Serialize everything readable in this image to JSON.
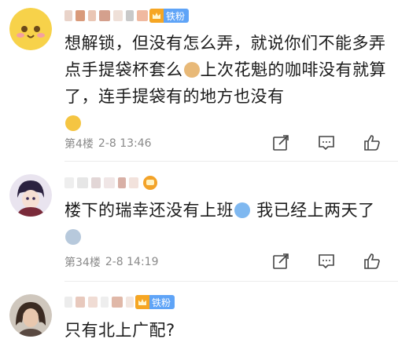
{
  "comments": [
    {
      "badge_label": "铁粉",
      "text_parts": [
        "想解锁，但没有怎么弄，就说你们不能多弄点手提袋杯套么",
        "上次花魁的咖啡没有就算了，连手提袋有的地方也没有"
      ],
      "floor": "第4楼",
      "time": "2-8 13:46",
      "emoji_names": [
        "doge-emoji",
        "smirk-emoji"
      ]
    },
    {
      "text_parts": [
        "楼下的瑞幸还没有上班",
        " 我已经上两天了"
      ],
      "floor": "第34楼",
      "time": "2-8 14:19",
      "emoji_names": [
        "sweat-emoji",
        "rain-cloud-emoji"
      ]
    },
    {
      "badge_label": "铁粉",
      "text_parts": [
        "只有北上广配?"
      ]
    }
  ],
  "icons": {
    "share": "share-icon",
    "comment": "comment-icon",
    "like": "thumbs-up-icon"
  },
  "colors": {
    "badge_blue": "#5fa4f7",
    "medal_orange": "#f3a329",
    "meta_gray": "#8a8a8a"
  }
}
